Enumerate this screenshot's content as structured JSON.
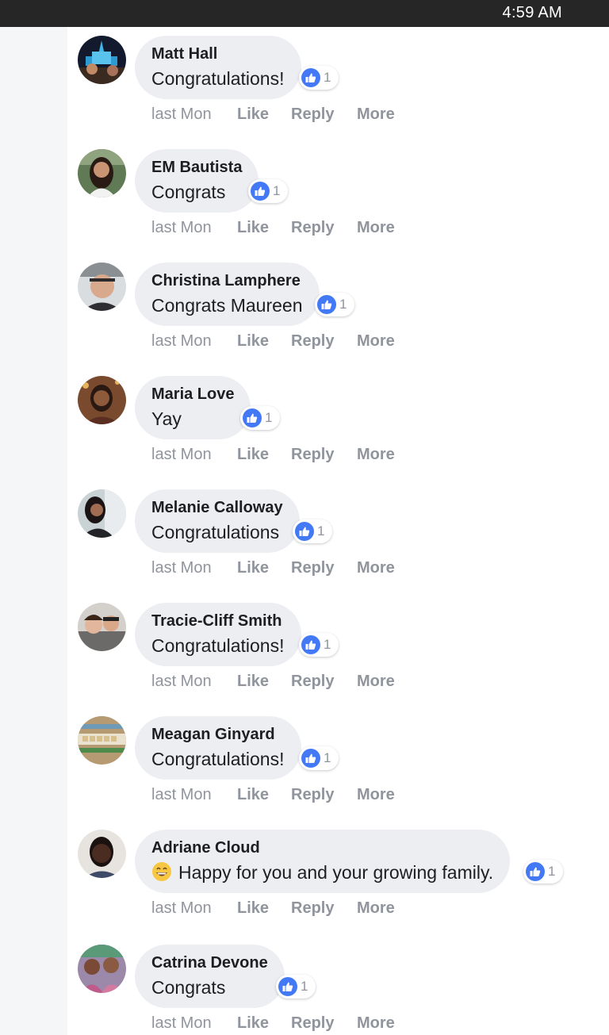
{
  "status_bar": {
    "time": "4:59 AM"
  },
  "actions": {
    "like": "Like",
    "reply": "Reply",
    "more": "More"
  },
  "icons": {
    "reaction": "like-thumbs-up-icon",
    "emoji": "grinning-face-emoji"
  },
  "colors": {
    "like_blue": "#4479f6",
    "bubble": "#eceef2",
    "muted": "#90949c"
  },
  "comments": [
    {
      "author": "Matt Hall",
      "text": "Congratulations!",
      "reaction_count": "1",
      "time": "last Mon"
    },
    {
      "author": "EM Bautista",
      "text": "Congrats",
      "reaction_count": "1",
      "time": "last Mon"
    },
    {
      "author": "Christina Lamphere",
      "text": "Congrats Maureen",
      "reaction_count": "1",
      "time": "last Mon"
    },
    {
      "author": "Maria Love",
      "text": "Yay",
      "reaction_count": "1",
      "time": "last Mon"
    },
    {
      "author": "Melanie Calloway",
      "text": "Congratulations",
      "reaction_count": "1",
      "time": "last Mon"
    },
    {
      "author": "Tracie-Cliff Smith",
      "text": "Congratulations!",
      "reaction_count": "1",
      "time": "last Mon"
    },
    {
      "author": "Meagan Ginyard",
      "text": "Congratulations!",
      "reaction_count": "1",
      "time": "last Mon"
    },
    {
      "author": "Adriane Cloud",
      "emoji": "😄",
      "text": "Happy for you and your growing family.",
      "reaction_count": "1",
      "time": "last Mon"
    },
    {
      "author": "Catrina Devone",
      "text": "Congrats",
      "reaction_count": "1",
      "time": "last Mon"
    }
  ]
}
